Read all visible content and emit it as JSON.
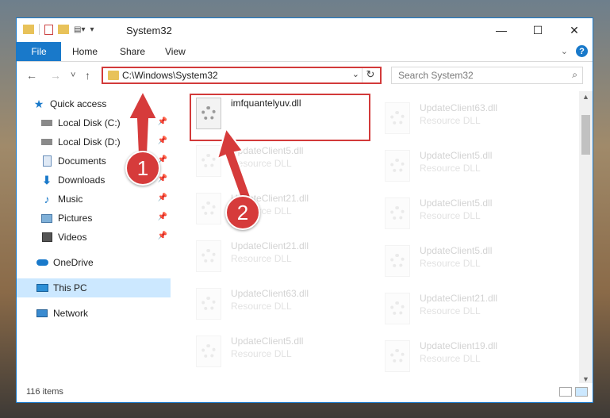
{
  "window": {
    "title": "System32",
    "controls": {
      "minimize": "—",
      "maximize": "☐",
      "close": "✕"
    }
  },
  "ribbon": {
    "tabs": [
      "File",
      "Home",
      "Share",
      "View"
    ]
  },
  "nav": {
    "back": "←",
    "forward": "→",
    "recent": "˅",
    "up": "↑",
    "address": "C:\\Windows\\System32",
    "search_placeholder": "Search System32"
  },
  "sidebar": {
    "items": [
      {
        "label": "Quick access",
        "icon": "star-icon",
        "pinned": false
      },
      {
        "label": "Local Disk (C:)",
        "icon": "drive-icon",
        "pinned": true
      },
      {
        "label": "Local Disk (D:)",
        "icon": "drive-icon",
        "pinned": true
      },
      {
        "label": "Documents",
        "icon": "documents-icon",
        "pinned": true
      },
      {
        "label": "Downloads",
        "icon": "downloads-icon",
        "pinned": true
      },
      {
        "label": "Music",
        "icon": "music-icon",
        "pinned": true
      },
      {
        "label": "Pictures",
        "icon": "pictures-icon",
        "pinned": true
      },
      {
        "label": "Videos",
        "icon": "videos-icon",
        "pinned": true
      },
      {
        "label": "OneDrive",
        "icon": "onedrive-icon",
        "pinned": false
      },
      {
        "label": "This PC",
        "icon": "pc-icon",
        "pinned": false,
        "selected": true
      },
      {
        "label": "Network",
        "icon": "network-icon",
        "pinned": false
      }
    ]
  },
  "files": {
    "col1": [
      {
        "name": "imfquantelyuv.dll",
        "type": "",
        "faded": false
      },
      {
        "name": "UpdateClient5.dll",
        "type": "Resource DLL",
        "faded": true
      },
      {
        "name": "UpdateClient21.dll",
        "type": "Resource DLL",
        "faded": true
      },
      {
        "name": "UpdateClient21.dll",
        "type": "Resource DLL",
        "faded": true
      },
      {
        "name": "UpdateClient63.dll",
        "type": "Resource DLL",
        "faded": true
      },
      {
        "name": "UpdateClient5.dll",
        "type": "Resource DLL",
        "faded": true
      }
    ],
    "col2": [
      {
        "name": "UpdateClient63.dll",
        "type": "Resource DLL",
        "faded": true
      },
      {
        "name": "UpdateClient5.dll",
        "type": "Resource DLL",
        "faded": true
      },
      {
        "name": "UpdateClient5.dll",
        "type": "Resource DLL",
        "faded": true
      },
      {
        "name": "UpdateClient5.dll",
        "type": "Resource DLL",
        "faded": true
      },
      {
        "name": "UpdateClient21.dll",
        "type": "Resource DLL",
        "faded": true
      },
      {
        "name": "UpdateClient19.dll",
        "type": "Resource DLL",
        "faded": true
      }
    ]
  },
  "annotations": {
    "step1": "1",
    "step2": "2",
    "color": "#d63b3b"
  },
  "status": {
    "count": "116 items"
  }
}
